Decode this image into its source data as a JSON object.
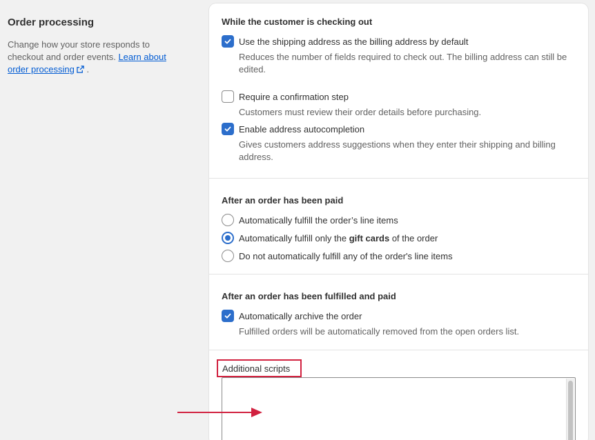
{
  "sidebar": {
    "title": "Order processing",
    "description_prefix": "Change how your store responds to checkout and order events. ",
    "link_text": "Learn about order processing",
    "description_suffix": " ."
  },
  "checkout": {
    "heading": "While the customer is checking out",
    "options": [
      {
        "label": "Use the shipping address as the billing address by default",
        "help": "Reduces the number of fields required to check out. The billing address can still be edited.",
        "checked": true
      },
      {
        "label": "Require a confirmation step",
        "help": "Customers must review their order details before purchasing.",
        "checked": false
      },
      {
        "label": "Enable address autocompletion",
        "help": "Gives customers address suggestions when they enter their shipping and billing address.",
        "checked": true
      }
    ]
  },
  "paid": {
    "heading": "After an order has been paid",
    "options": [
      {
        "label": "Automatically fulfill the order’s line items",
        "selected": false
      },
      {
        "label_prefix": "Automatically fulfill only the ",
        "label_bold": "gift cards",
        "label_suffix": " of the order",
        "selected": true
      },
      {
        "label": "Do not automatically fulfill any of the order's line items",
        "selected": false
      }
    ]
  },
  "fulfilled": {
    "heading": "After an order has been fulfilled and paid",
    "option": {
      "label": "Automatically archive the order",
      "help": "Fulfilled orders will be automatically removed from the open orders list.",
      "checked": true
    }
  },
  "scripts": {
    "label": "Additional scripts",
    "value": ""
  },
  "colors": {
    "accent": "#2c6ecb",
    "highlight": "#d1213f",
    "link": "#005bd3"
  },
  "icons": {
    "external_link": "external-link-icon",
    "checkmark": "checkmark-icon",
    "annotation_arrow": "arrow-right-icon"
  }
}
